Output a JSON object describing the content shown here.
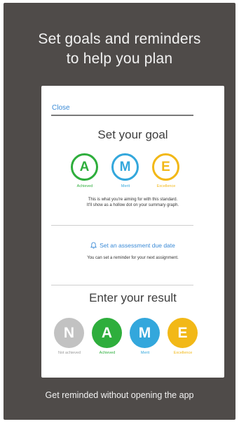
{
  "headline": {
    "line1": "Set goals and reminders",
    "line2": "to help you plan"
  },
  "card": {
    "close_label": "Close",
    "goal": {
      "title": "Set your goal",
      "options": [
        {
          "letter": "A",
          "label": "Achieved",
          "color": "#2eae3c"
        },
        {
          "letter": "M",
          "label": "Merit",
          "color": "#33a7dc"
        },
        {
          "letter": "E",
          "label": "Excellence",
          "color": "#f2b817"
        }
      ],
      "desc_line1": "This is what you're aiming for with this standard.",
      "desc_line2": "It'll show as a hollow dot on your summary graph."
    },
    "reminder": {
      "icon": "bell-icon",
      "link_label": "Set an assessment due date",
      "desc": "You can set a reminder for your next assignment."
    },
    "result": {
      "title": "Enter your result",
      "options": [
        {
          "letter": "N",
          "label": "Not achieved",
          "color": "#c2c2c2"
        },
        {
          "letter": "A",
          "label": "Achieved",
          "color": "#2eae3c"
        },
        {
          "letter": "M",
          "label": "Merit",
          "color": "#33a7dc"
        },
        {
          "letter": "E",
          "label": "Excellence",
          "color": "#f2b817"
        }
      ]
    }
  },
  "footer": "Get reminded without opening the app",
  "colors": {
    "background": "#4f4b49",
    "link": "#3a8ad6"
  }
}
